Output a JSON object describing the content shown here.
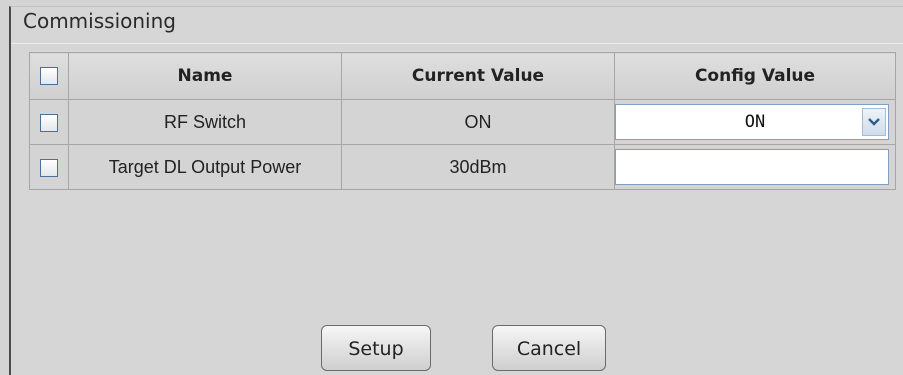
{
  "panel": {
    "title": "Commissioning"
  },
  "table": {
    "headers": {
      "name": "Name",
      "current": "Current Value",
      "config": "Config Value"
    },
    "rows": [
      {
        "name": "RF Switch",
        "current": "ON",
        "config": "ON"
      },
      {
        "name": "Target DL Output Power",
        "current": "30dBm",
        "config": ""
      }
    ]
  },
  "buttons": {
    "setup": "Setup",
    "cancel": "Cancel"
  }
}
